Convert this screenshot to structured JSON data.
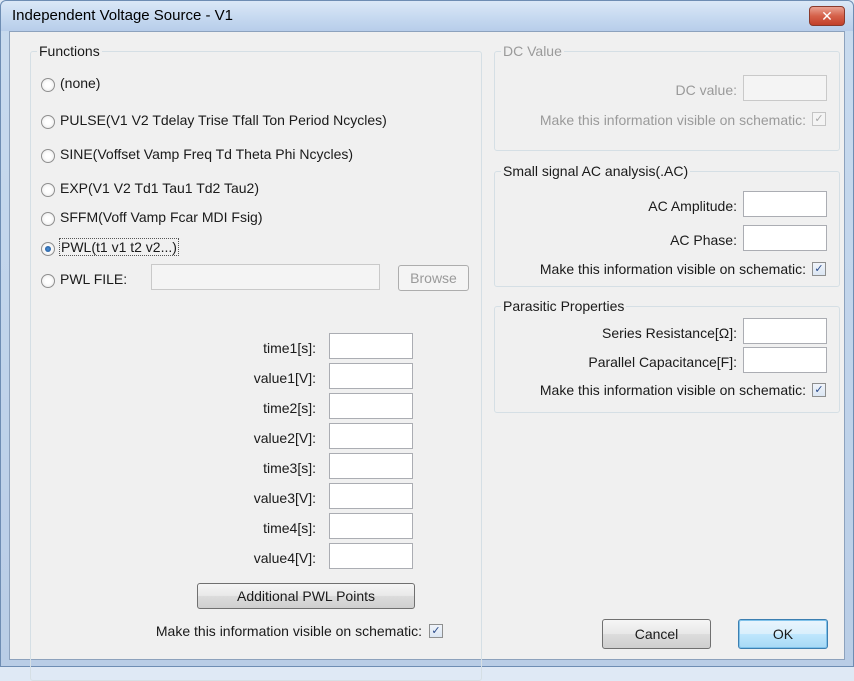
{
  "window": {
    "title": "Independent Voltage Source - V1",
    "close_glyph": "✕"
  },
  "functions": {
    "title": "Functions",
    "options": [
      {
        "label": "(none)",
        "checked": false
      },
      {
        "label": "PULSE(V1 V2 Tdelay Trise Tfall Ton Period Ncycles)",
        "checked": false
      },
      {
        "label": "SINE(Voffset Vamp Freq Td Theta Phi Ncycles)",
        "checked": false
      },
      {
        "label": "EXP(V1 V2 Td1 Tau1 Td2 Tau2)",
        "checked": false
      },
      {
        "label": "SFFM(Voff Vamp Fcar MDI Fsig)",
        "checked": false
      },
      {
        "label": "PWL(t1 v1 t2 v2...)",
        "checked": true
      },
      {
        "label": "PWL FILE:",
        "checked": false
      }
    ],
    "pwl_file_value": "",
    "browse_label": "Browse",
    "fields": [
      {
        "label": "time1[s]:",
        "value": ""
      },
      {
        "label": "value1[V]:",
        "value": ""
      },
      {
        "label": "time2[s]:",
        "value": ""
      },
      {
        "label": "value2[V]:",
        "value": ""
      },
      {
        "label": "time3[s]:",
        "value": ""
      },
      {
        "label": "value3[V]:",
        "value": ""
      },
      {
        "label": "time4[s]:",
        "value": ""
      },
      {
        "label": "value4[V]:",
        "value": ""
      }
    ],
    "additional_label": "Additional PWL Points",
    "visible_label": "Make this information visible on schematic:",
    "visible_checked": true
  },
  "dc": {
    "title": "DC Value",
    "value_label": "DC value:",
    "value": "",
    "visible_label": "Make this information visible on schematic:",
    "visible_checked": true
  },
  "ac": {
    "title": "Small signal AC analysis(.AC)",
    "amplitude_label": "AC Amplitude:",
    "amplitude_value": "",
    "phase_label": "AC Phase:",
    "phase_value": "",
    "visible_label": "Make this information visible on schematic:",
    "visible_checked": true
  },
  "parasitic": {
    "title": "Parasitic Properties",
    "series_label": "Series Resistance[Ω]:",
    "series_value": "",
    "parallel_label": "Parallel Capacitance[F]:",
    "parallel_value": "",
    "visible_label": "Make this information visible on schematic:",
    "visible_checked": true
  },
  "buttons": {
    "cancel": "Cancel",
    "ok": "OK"
  },
  "check_glyph": "✓"
}
